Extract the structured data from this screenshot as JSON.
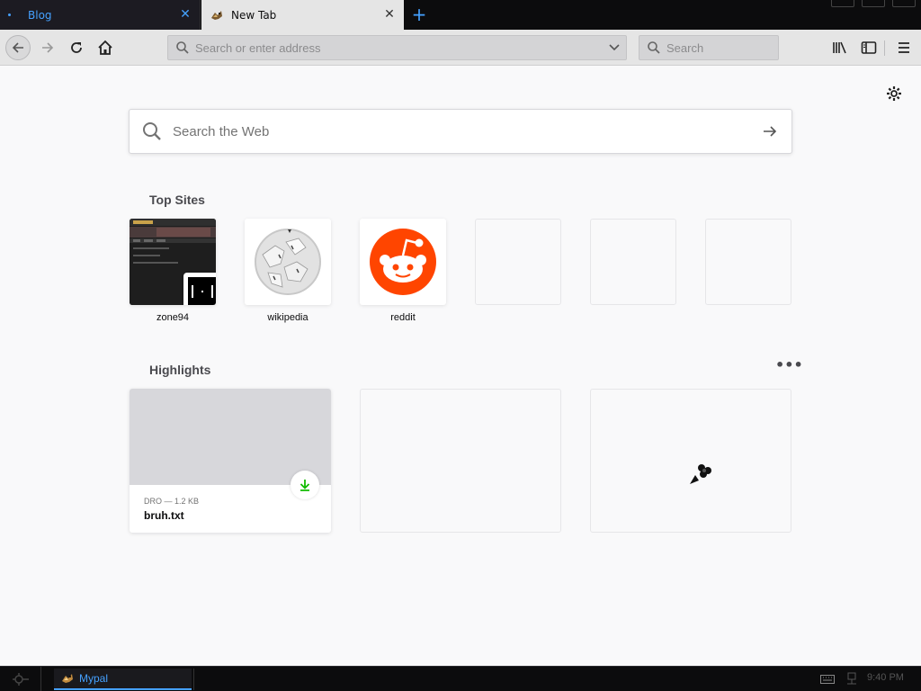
{
  "tabs": [
    {
      "label": "Blog",
      "active": false
    },
    {
      "label": "New Tab",
      "active": true
    }
  ],
  "icons": {
    "new_tab": "+",
    "close": "✕",
    "more": "•••"
  },
  "navbar": {
    "url_placeholder": "Search or enter address",
    "search_placeholder": "Search"
  },
  "newtab": {
    "web_search_placeholder": "Search the Web",
    "top_sites_title": "Top Sites",
    "highlights_title": "Highlights",
    "top_sites": [
      {
        "label": "zone94"
      },
      {
        "label": "wikipedia"
      },
      {
        "label": "reddit"
      },
      {
        "label": ""
      },
      {
        "label": ""
      },
      {
        "label": ""
      }
    ],
    "highlights": [
      {
        "meta": "DRO — 1.2 KB",
        "name": "bruh.txt"
      }
    ]
  },
  "taskbar": {
    "task_label": "Mypal",
    "clock": "9:40 PM"
  },
  "colors": {
    "accent": "#45a1ff",
    "reddit": "#ff4500",
    "download_green": "#12bc00"
  }
}
